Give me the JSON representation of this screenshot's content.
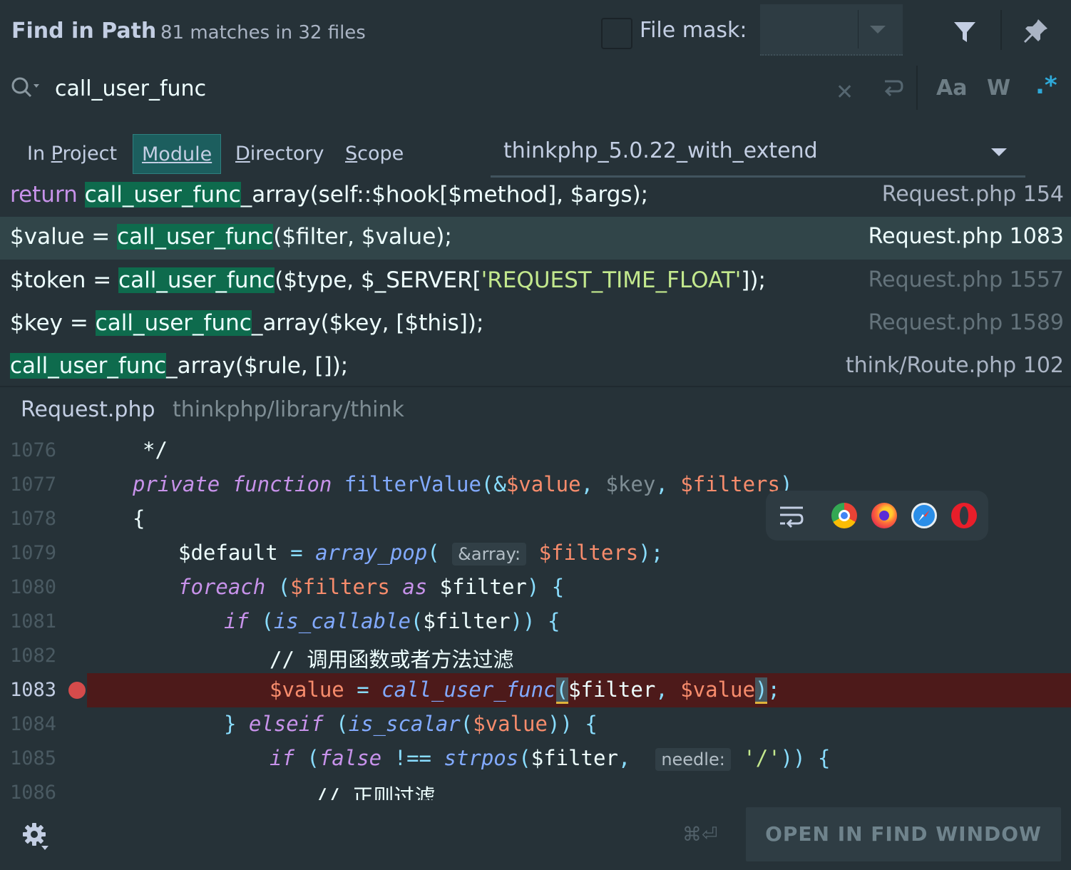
{
  "header": {
    "title": "Find in Path",
    "subtitle": "81 matches in 32 files",
    "file_mask_label": "File mask:",
    "file_mask_checked": false
  },
  "search": {
    "query": "call_user_func",
    "case_label": "Aa",
    "word_label": "W",
    "regex_label": ".*"
  },
  "scope": {
    "tabs": [
      {
        "pre": "In ",
        "ul": "P",
        "post": "roject"
      },
      {
        "pre": "",
        "ul": "M",
        "post": "odule"
      },
      {
        "pre": "",
        "ul": "D",
        "post": "irectory"
      },
      {
        "pre": "",
        "ul": "S",
        "post": "cope"
      }
    ],
    "active_tab": "Module",
    "module": "thinkphp_5.0.22_with_extend"
  },
  "results": [
    {
      "file": "Request.php 154",
      "parts": [
        "return ",
        "call_user_func",
        "_array(self::$hook[$method], $args);"
      ]
    },
    {
      "file": "Request.php 1083",
      "parts": [
        "$value = ",
        "call_user_func",
        "($filter, $value);"
      ]
    },
    {
      "file": "Request.php 1557",
      "parts": [
        "$token = ",
        "call_user_func",
        "($type, $_SERVER['REQUEST_TIME_FLOAT']);"
      ]
    },
    {
      "file": "Request.php 1589",
      "parts": [
        "$key = ",
        "call_user_func",
        "_array($key, [$this]);"
      ]
    },
    {
      "file": "think/Route.php 102",
      "parts": [
        "",
        "call_user_func",
        "_array($rule, []);"
      ]
    }
  ],
  "selected_result": 1,
  "preview": {
    "file": "Request.php",
    "path": "thinkphp/library/think",
    "line_numbers": [
      "1076",
      "1077",
      "1078",
      "1079",
      "1080",
      "1081",
      "1082",
      "1083",
      "1084",
      "1085",
      "1086"
    ],
    "current_line": "1083",
    "comment1": "*/",
    "l1077": {
      "kw1": "private",
      "kw2": "function",
      "fn": "filterValue",
      "p1": "(&",
      "v1": "$value",
      "sep1": ", ",
      "v2": "$key",
      "sep2": ", ",
      "v3": "$filters",
      "p2": ")"
    },
    "brace_open": "{",
    "l1079": {
      "var": "$default",
      "eq": " = ",
      "fn": "array_pop",
      "p1": "( ",
      "hint": "&array:",
      "v": "$filters",
      "p2": ");"
    },
    "l1080": {
      "kw": "foreach",
      "p1": " (",
      "v1": "$filters",
      "as": " as ",
      "v2": "$filter",
      "p2": ") {"
    },
    "l1081": {
      "kw": "if",
      "p1": " (",
      "fn": "is_callable",
      "p2": "(",
      "v": "$filter",
      "p3": ")) {"
    },
    "comment2": "// 调用函数或者方法过滤",
    "l1083": {
      "v1": "$value",
      "eq": " = ",
      "fn": "call_user_func",
      "p1": "(",
      "v2": "$filter",
      "sep": ", ",
      "v3": "$value",
      "p2": ")",
      "end": ";"
    },
    "l1084": {
      "p0": "} ",
      "kw": "elseif",
      "p1": " (",
      "fn": "is_scalar",
      "p2": "(",
      "v": "$value",
      "p3": ")) {"
    },
    "l1085": {
      "kw": "if",
      "p1": " (",
      "kw2": "false",
      "op": " !== ",
      "fn": "strpos",
      "p2": "(",
      "v": "$filter",
      "sep": ", ",
      "hint": "needle:",
      "s": "'/'",
      "p3": ")) {"
    },
    "comment3": "// 正则过滤"
  },
  "browsers": [
    "chrome-icon",
    "firefox-icon",
    "safari-icon",
    "opera-icon"
  ],
  "footer": {
    "shortcut": "⌘⏎",
    "open_button": "OPEN IN FIND WINDOW"
  }
}
